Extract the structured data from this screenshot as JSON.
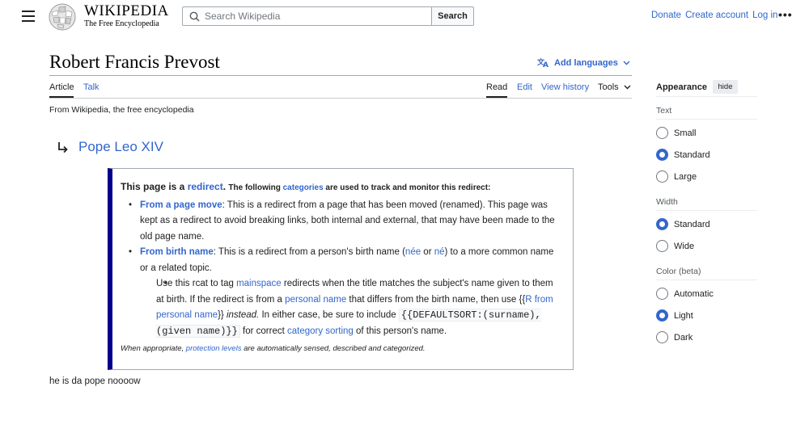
{
  "header": {
    "wordmark_title": "WIKIPEDIA",
    "wordmark_tagline": "The Free Encyclopedia",
    "search_placeholder": "Search Wikipedia",
    "search_button": "Search",
    "top_links": [
      "Donate",
      "Create account",
      "Log in"
    ],
    "more_icon": "ellipsis-icon"
  },
  "article": {
    "title": "Robert Francis Prevost",
    "add_languages": "Add languages",
    "tabs_left": [
      "Article",
      "Talk"
    ],
    "tabs_right": [
      "Read",
      "Edit",
      "View history",
      "Tools"
    ],
    "from_wikipedia": "From Wikipedia, the free encyclopedia",
    "redirect_target": "Pope Leo XIV",
    "body_text": "he is da pope noooow"
  },
  "mbox": {
    "lead_a": "This page is a ",
    "lead_link": "redirect",
    "lead_b": ". ",
    "lead_small_a": "The following ",
    "lead_small_link": "categories",
    "lead_small_b": " are used to track and monitor this redirect:",
    "item1_link": "From a page move",
    "item1_text": ": This is a redirect from a page that has been moved (renamed). This page was kept as a redirect to avoid breaking links, both internal and external, that may have been made to the old page name.",
    "item2_link": "From birth name",
    "item2_text_a": ": This is a redirect from a person's birth name (",
    "item2_link_nee": "née",
    "item2_or": " or ",
    "item2_link_ne": "né",
    "item2_text_b": ") to a more common name or a related topic.",
    "sub_a": "Use this rcat to tag ",
    "sub_link_mainspace": "mainspace",
    "sub_b": " redirects when the title matches the subject's name given to them at birth. If the redirect is from a ",
    "sub_link_personal": "personal name",
    "sub_c": " that differs from the birth name, then use {{",
    "sub_link_template": "R from personal name",
    "sub_d": "}} ",
    "sub_instead": "instead.",
    "sub_e": " In either case, be sure to include ",
    "sub_code": "{{DEFAULTSORT:(surname), (given name)}}",
    "sub_f": " for correct ",
    "sub_link_sorting": "category sorting",
    "sub_g": " of this person's name.",
    "foot_a": "When appropriate, ",
    "foot_link": "protection levels",
    "foot_b": " are automatically sensed, described and categorized."
  },
  "appearance": {
    "title": "Appearance",
    "hide": "hide",
    "text_label": "Text",
    "text_options": [
      "Small",
      "Standard",
      "Large"
    ],
    "text_selected": "Standard",
    "width_label": "Width",
    "width_options": [
      "Standard",
      "Wide"
    ],
    "width_selected": "Standard",
    "color_label": "Color (beta)",
    "color_options": [
      "Automatic",
      "Light",
      "Dark"
    ],
    "color_selected": "Light"
  },
  "colors": {
    "link": "#3366cc",
    "mbox_border": "#00008b",
    "text": "#202122"
  }
}
